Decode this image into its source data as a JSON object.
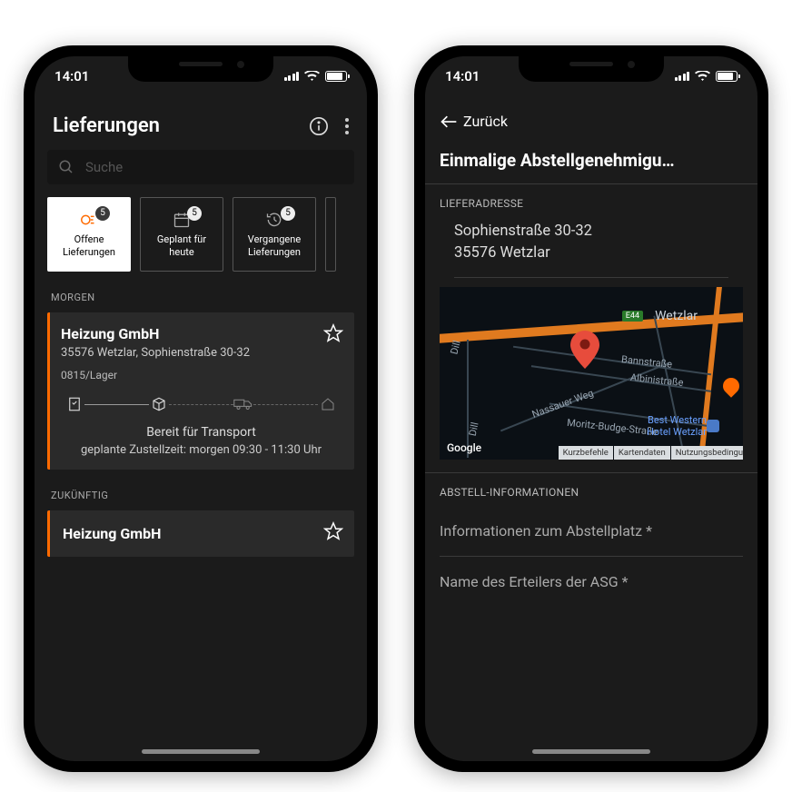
{
  "status_time": "14:01",
  "left": {
    "title": "Lieferungen",
    "search_placeholder": "Suche",
    "tabs": [
      {
        "label_l1": "Offene",
        "label_l2": "Lieferungen",
        "count": "5"
      },
      {
        "label_l1": "Geplant für",
        "label_l2": "heute",
        "count": "5"
      },
      {
        "label_l1": "Vergangene",
        "label_l2": "Lieferungen",
        "count": "5"
      }
    ],
    "section_morgen": "MORGEN",
    "card": {
      "company": "Heizung GmbH",
      "address": "35576 Wetzlar, Sophienstraße 30-32",
      "reference": "0815/Lager",
      "status": "Bereit für Transport",
      "eta": "geplante Zustellzeit: morgen 09:30 - 11:30 Uhr"
    },
    "section_zukuenftig": "ZUKÜNFTIG",
    "card2": {
      "company": "Heizung GmbH"
    }
  },
  "right": {
    "back": "Zurück",
    "title": "Einmalige Abstellgenehmigu…",
    "sec_lieferadresse": "LIEFERADRESSE",
    "addr_line1": "Sophienstraße 30-32",
    "addr_line2": "35576 Wetzlar",
    "map": {
      "city": "Wetzlar",
      "e44": "E44",
      "bann": "Bannstraße",
      "alb": "Albinistraße",
      "nas": "Nassauer Weg",
      "mor": "Moritz-Budge-Straße",
      "dill": "Dill",
      "hotel": "Best Western\nHotel Wetzlar",
      "google": "Google",
      "attrib1": "Kurzbefehle",
      "attrib2": "Kartendaten",
      "attrib3": "Nutzungsbedingungen"
    },
    "sec_abstell": "ABSTELL-INFORMATIONEN",
    "input1": "Informationen zum Abstellplatz *",
    "input2": "Name des Erteilers der ASG *"
  }
}
